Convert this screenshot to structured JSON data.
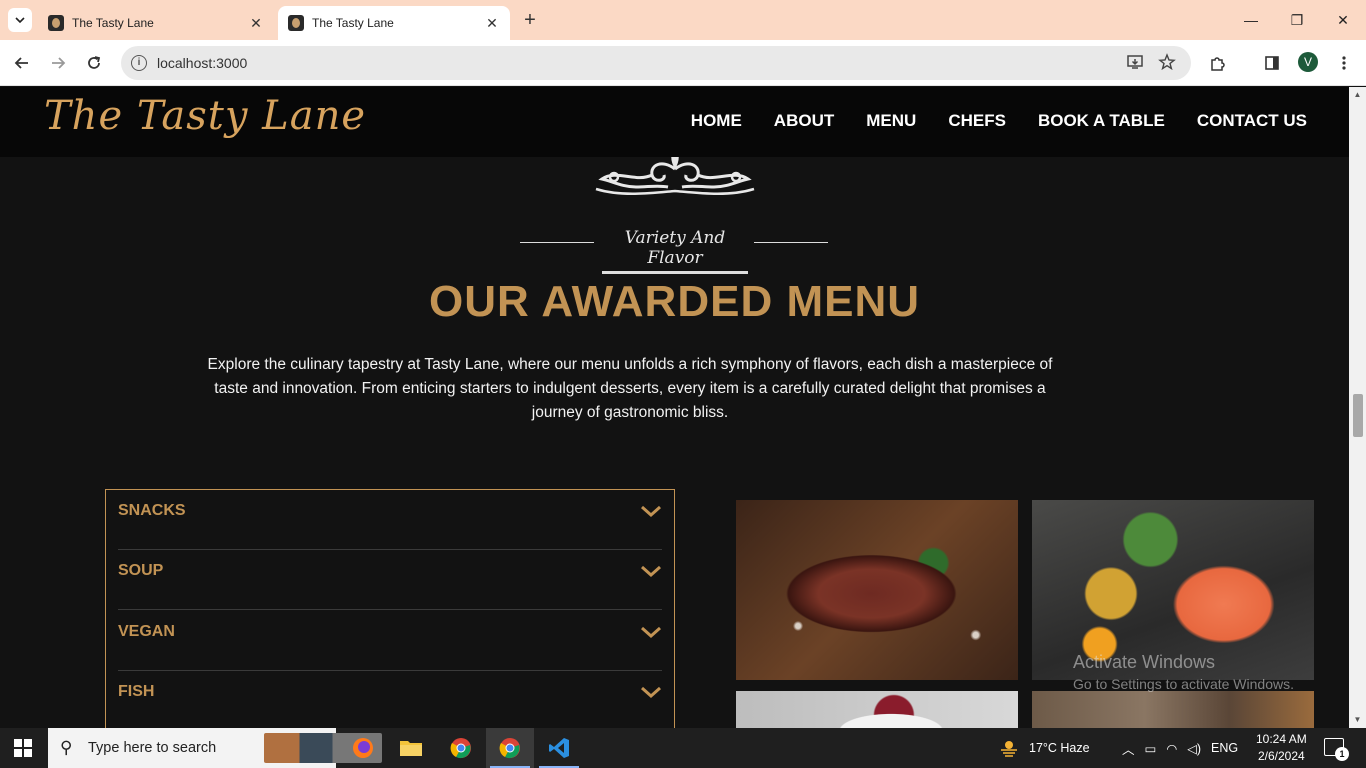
{
  "browser": {
    "tabs": [
      {
        "title": "The Tasty Lane",
        "active": false
      },
      {
        "title": "The Tasty Lane",
        "active": true
      }
    ],
    "address": "localhost:3000",
    "profile_initial": "V",
    "window_controls": {
      "minimize": "—",
      "restore": "❐",
      "close": "✕"
    }
  },
  "site": {
    "logo": "The Tasty Lane",
    "nav": [
      "HOME",
      "ABOUT",
      "MENU",
      "CHEFS",
      "BOOK A TABLE",
      "CONTACT US"
    ],
    "subtitle": "Variety And Flavor",
    "title": "OUR AWARDED MENU",
    "intro": "Explore the culinary tapestry at Tasty Lane, where our menu unfolds a rich symphony of flavors, each dish a masterpiece of taste and innovation. From enticing starters to indulgent desserts, every item is a carefully curated delight that promises a journey of gastronomic bliss.",
    "menu_categories": [
      "SNACKS",
      "SOUP",
      "VEGAN",
      "FISH"
    ],
    "accent_color": "#c29354",
    "images": [
      "steak",
      "salmon",
      "dessert",
      "table-setting"
    ]
  },
  "watermark": {
    "line1": "Activate Windows",
    "line2": "Go to Settings to activate Windows."
  },
  "taskbar": {
    "search_placeholder": "Type here to search",
    "weather": "17°C  Haze",
    "language": "ENG",
    "time": "10:24 AM",
    "date": "2/6/2024",
    "notification_count": "1"
  }
}
